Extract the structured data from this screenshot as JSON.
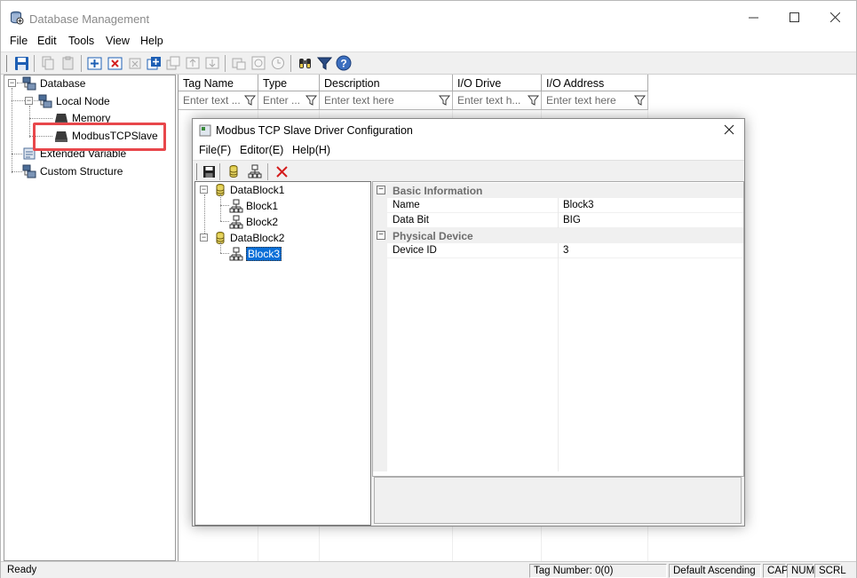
{
  "window": {
    "title": "Database Management",
    "menu": [
      "File",
      "Edit",
      "Tools",
      "View",
      "Help"
    ]
  },
  "tree": {
    "root": "Database",
    "local_node": "Local Node",
    "memory": "Memory",
    "modbus": "ModbusTCPSlave",
    "extended": "Extended Variable",
    "custom": "Custom Structure"
  },
  "grid": {
    "columns": [
      {
        "label": "Tag Name",
        "filter_placeholder": "Enter text ..."
      },
      {
        "label": "Type",
        "filter_placeholder": "Enter ..."
      },
      {
        "label": "Description",
        "filter_placeholder": "Enter text here"
      },
      {
        "label": "I/O Drive",
        "filter_placeholder": "Enter text h..."
      },
      {
        "label": "I/O Address",
        "filter_placeholder": "Enter text here"
      }
    ]
  },
  "status": {
    "ready": "Ready",
    "tag_number": "Tag Number: 0(0)",
    "sort": "Default Ascending",
    "cap": "CAP",
    "num": "NUM",
    "scrl": "SCRL"
  },
  "dialog": {
    "title": "Modbus TCP Slave Driver Configuration",
    "menu": [
      "File(F)",
      "Editor(E)",
      "Help(H)"
    ],
    "tree": {
      "block_group_1": "DataBlock1",
      "block_1": "Block1",
      "block_2": "Block2",
      "block_group_2": "DataBlock2",
      "block_3": "Block3"
    },
    "properties": {
      "cat_basic": "Basic Information",
      "name_label": "Name",
      "name_value": "Block3",
      "databit_label": "Data Bit",
      "databit_value": "BIG",
      "cat_physical": "Physical Device",
      "device_label": "Device ID",
      "device_value": "3"
    }
  },
  "colors": {
    "highlight": "#e8474b",
    "selection": "#0a6fd8",
    "accent_blue": "#1e5fb4"
  },
  "icons": {
    "app": "database-icon",
    "save": "save-icon",
    "filter": "funnel-icon",
    "delete": "red-x-icon",
    "help": "help-icon"
  }
}
